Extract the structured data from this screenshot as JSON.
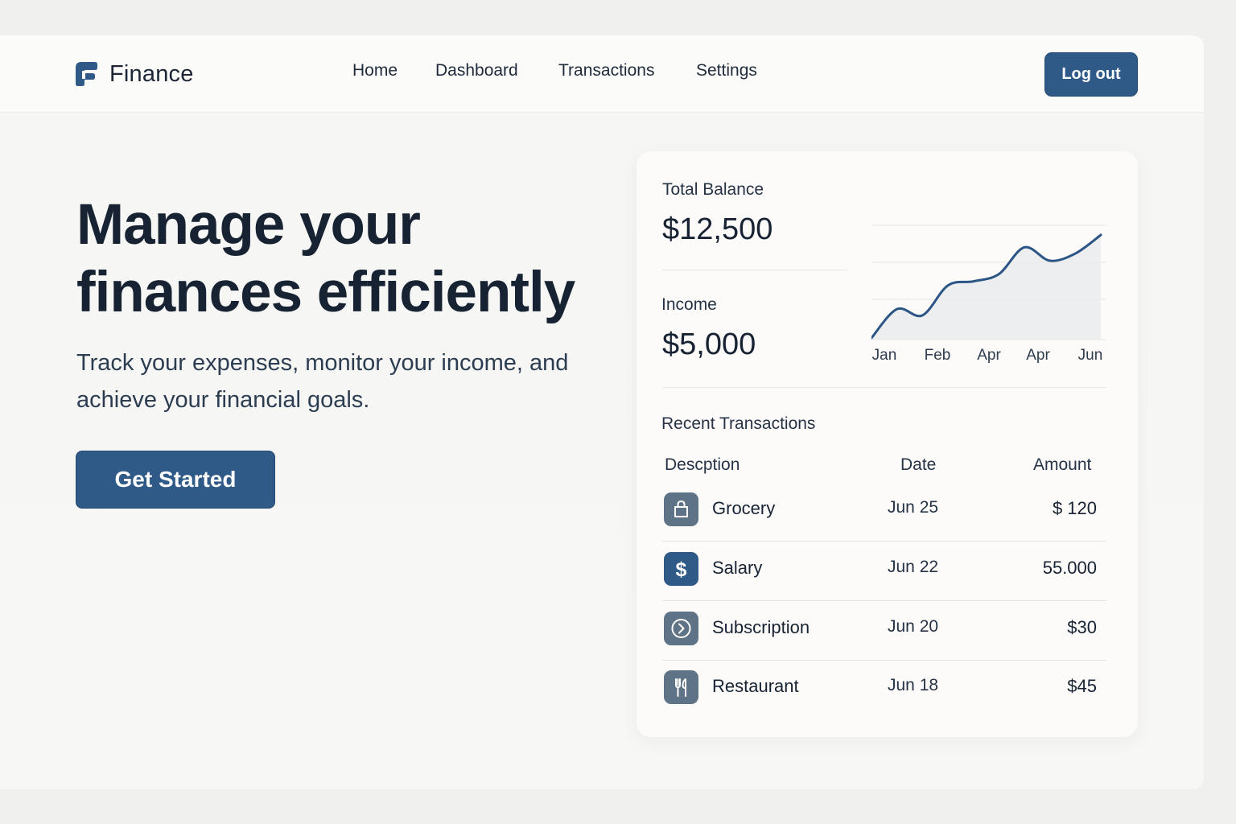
{
  "brand": {
    "name": "Finance"
  },
  "nav": {
    "links": [
      "Home",
      "Dashboard",
      "Transactions",
      "Settings"
    ],
    "logout_label": "Log out"
  },
  "hero": {
    "title": "Manage your finances efficiently",
    "subtitle": "Track your expenses, monitor your income, and achieve your financial goals.",
    "cta_label": "Get Started"
  },
  "summary": {
    "balance_label": "Total Balance",
    "balance_value": "$12,500",
    "income_label": "Income",
    "income_value": "$5,000"
  },
  "chart_data": {
    "type": "area",
    "x": [
      "Jan",
      "Feb",
      "Apr",
      "Apr",
      "Jun"
    ],
    "series": [
      {
        "values": [
          0,
          0.28,
          0.22,
          0.51,
          0.55,
          0.62,
          0.88,
          0.75,
          0.82,
          1.0
        ]
      }
    ],
    "grid": true,
    "ylabel": "",
    "xlabel": ""
  },
  "transactions": {
    "title": "Recent Transactions",
    "headers": {
      "description": "Descption",
      "date": "Date",
      "amount": "Amount"
    },
    "rows": [
      {
        "description": "Grocery",
        "date": "Jun 25",
        "amount": "$ 120",
        "icon": "shopping-bag-icon"
      },
      {
        "description": "Salary",
        "date": "Jun 22",
        "amount": "55.000",
        "icon": "dollar-icon"
      },
      {
        "description": "Subscription",
        "date": "Jun 20",
        "amount": "$30",
        "icon": "play-circle-icon"
      },
      {
        "description": "Restaurant",
        "date": "Jun 18",
        "amount": "$45",
        "icon": "fork-knife-icon"
      }
    ]
  },
  "colors": {
    "primary": "#2f5a88",
    "text": "#172233",
    "chart_line": "#2b5584",
    "icon_gray": "#5f7386"
  }
}
